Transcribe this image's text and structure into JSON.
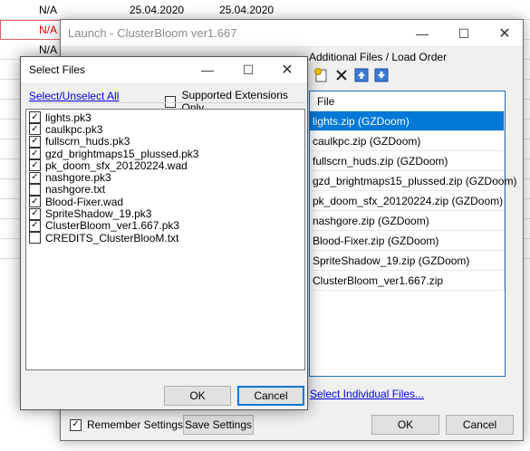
{
  "background": {
    "rows": [
      {
        "c1": "N/A",
        "c2": "25.04.2020",
        "c3": "25.04.2020",
        "red": false
      },
      {
        "c1": "N/A",
        "c2": "",
        "c3": "",
        "red": true
      },
      {
        "c1": "N/A",
        "c2": "",
        "c3": "",
        "red": false
      }
    ]
  },
  "launch": {
    "title": "Launch - ClusterBloom ver1.667",
    "group_label": "Additional Files / Load Order",
    "list_header": "File",
    "files": [
      "lights.zip (GZDoom)",
      "caulkpc.zip (GZDoom)",
      "fullscrn_huds.zip (GZDoom)",
      "gzd_brightmaps15_plussed.zip (GZDoom)",
      "pk_doom_sfx_20120224.zip (GZDoom)",
      "nashgore.zip (GZDoom)",
      "Blood-Fixer.zip (GZDoom)",
      "SpriteShadow_19.zip (GZDoom)",
      "ClusterBloom_ver1.667.zip"
    ],
    "select_individual": "Select Individual Files...",
    "remember_settings": "Remember Settings",
    "save_settings": "Save Settings",
    "ok": "OK",
    "cancel": "Cancel"
  },
  "dialog": {
    "title": "Select Files",
    "select_unselect": "Select/Unselect All",
    "supported_only": "Supported Extensions Only",
    "items": [
      {
        "name": "lights.pk3",
        "checked": true
      },
      {
        "name": "caulkpc.pk3",
        "checked": true
      },
      {
        "name": "fullscrn_huds.pk3",
        "checked": true
      },
      {
        "name": "gzd_brightmaps15_plussed.pk3",
        "checked": true
      },
      {
        "name": "pk_doom_sfx_20120224.wad",
        "checked": true
      },
      {
        "name": "nashgore.pk3",
        "checked": true
      },
      {
        "name": "nashgore.txt",
        "checked": false
      },
      {
        "name": "Blood-Fixer.wad",
        "checked": true
      },
      {
        "name": "SpriteShadow_19.pk3",
        "checked": true
      },
      {
        "name": "ClusterBloom_ver1.667.pk3",
        "checked": true
      },
      {
        "name": "CREDITS_ClusterBlooM.txt",
        "checked": false
      }
    ],
    "ok": "OK",
    "cancel": "Cancel"
  },
  "icons": {
    "minimize": "—",
    "maximize": "☐",
    "close": "✕",
    "check": "✓"
  }
}
